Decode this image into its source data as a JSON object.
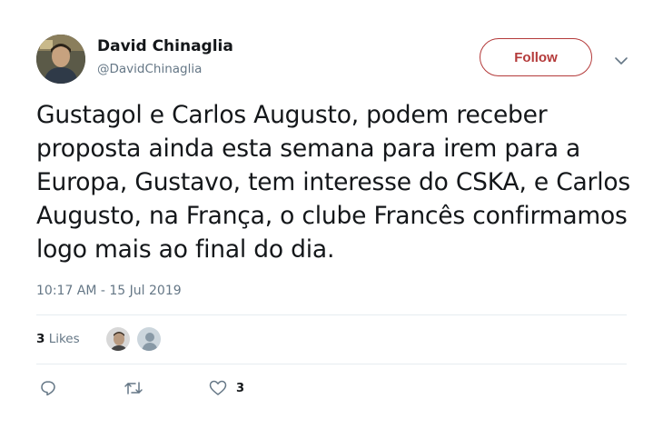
{
  "author": {
    "display_name": "David Chinaglia",
    "handle": "@DavidChinaglia"
  },
  "follow_button": {
    "label": "Follow"
  },
  "tweet": {
    "text": "Gustagol e Carlos Augusto, podem receber proposta ainda esta semana para irem para a Europa, Gustavo, tem interesse do CSKA, e Carlos Augusto, na França, o clube Francês confirmamos logo mais ao final do dia.",
    "timestamp": "10:17 AM - 15 Jul 2019"
  },
  "stats": {
    "likes_count": "3",
    "likes_label": "Likes"
  },
  "actions": {
    "like_count": "3"
  },
  "icons": {
    "caret": "chevron-down-icon",
    "reply": "reply-icon",
    "retweet": "retweet-icon",
    "like": "heart-icon"
  },
  "colors": {
    "follow_accent": "#b43a3a",
    "secondary_text": "#657786",
    "divider": "#e6ecf0"
  }
}
